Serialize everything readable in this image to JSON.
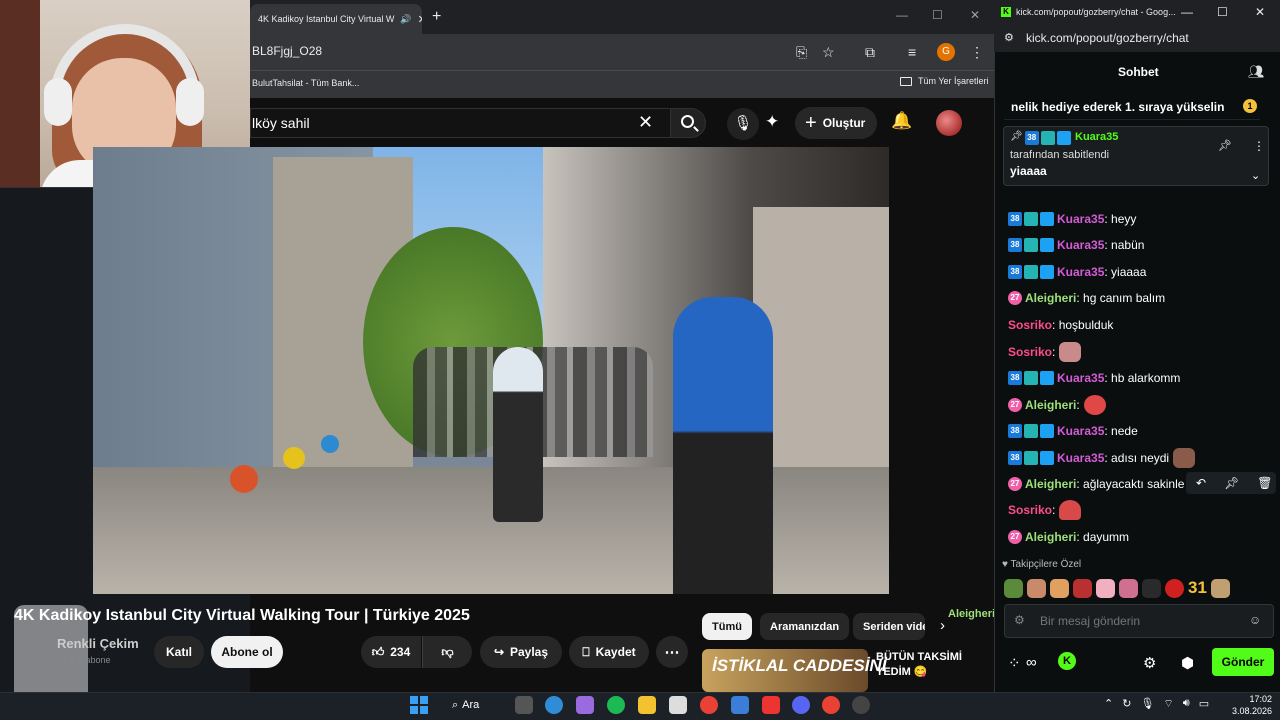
{
  "youtube_browser": {
    "tab_title": "4K Kadikoy Istanbul City Virtual W",
    "url": "BL8Fjgj_O28",
    "bookmark": "BulutTahsilat - Tüm Bank...",
    "all_bookmarks": "Tüm Yer İşaretleri",
    "profile_initial": "G"
  },
  "youtube": {
    "search_query": "lköy sahil",
    "create_label": "Oluştur",
    "video_title": "4K Kadikoy Istanbul City Virtual Walking Tour | Türkiye 2025",
    "channel_name": "Renkli Çekim",
    "channel_subs": "2.3 B abone",
    "join_label": "Katıl",
    "subscribe_label": "Abone ol",
    "likes": "234",
    "share_label": "Paylaş",
    "save_label": "Kaydet",
    "chips": [
      "Tümü",
      "Aramanızdan",
      "Seriden vide"
    ],
    "rec_thumb_text": "İSTİKLAL CADDESİNİ",
    "rec_title": "BÜTÜN TAKSİMİ YEDİM 😋",
    "overlay_user": "Aleigheri",
    "overlay_msg": "dayumm"
  },
  "kick_window": {
    "window_title": "kick.com/popout/gozberry/chat - Goog...",
    "url": "kick.com/popout/gozberry/chat"
  },
  "chat": {
    "header": "Sohbet",
    "gift_banner": "nelik hediye ederek 1. sıraya yükselin",
    "gift_badge": "1",
    "pinned_user": "Kuara35",
    "pinned_by": "tarafından sabitlendi",
    "pinned_msg": "yiaaaa",
    "messages": [
      {
        "user": "Kuara35",
        "text": "heyy"
      },
      {
        "user": "Kuara35",
        "text": "nabün"
      },
      {
        "user": "Kuara35",
        "text": "yiaaaa"
      },
      {
        "user": "Aleigheri",
        "text": "hg canım balım"
      },
      {
        "user": "Sosriko",
        "text": "hoşbulduk"
      },
      {
        "user": "Sosriko",
        "text": ""
      },
      {
        "user": "Kuara35",
        "text": "hb alarkomm"
      },
      {
        "user": "Aleigheri",
        "text": ""
      },
      {
        "user": "Kuara35",
        "text": "nede"
      },
      {
        "user": "Kuara35",
        "text": "adısı neydi"
      },
      {
        "user": "Aleigheri",
        "text": "ağlayacaktı sakinle"
      },
      {
        "user": "Sosriko",
        "text": ""
      },
      {
        "user": "Aleigheri",
        "text": "dayumm"
      }
    ],
    "sub_badge": "38",
    "aleig_badge": "27",
    "followers_label": "Takipçilere Özel",
    "emote_number": "31",
    "input_placeholder": "Bir mesaj gönderin",
    "send_label": "Gönder"
  },
  "taskbar": {
    "search_label": "Ara",
    "time": "17:02",
    "date": "3.08.2026"
  },
  "colors": {
    "kick_green": "#53fc18",
    "kuara_color": "#d45bd6",
    "aleigheri_color": "#9ee07a",
    "sosriko_color": "#ff4d8a"
  }
}
